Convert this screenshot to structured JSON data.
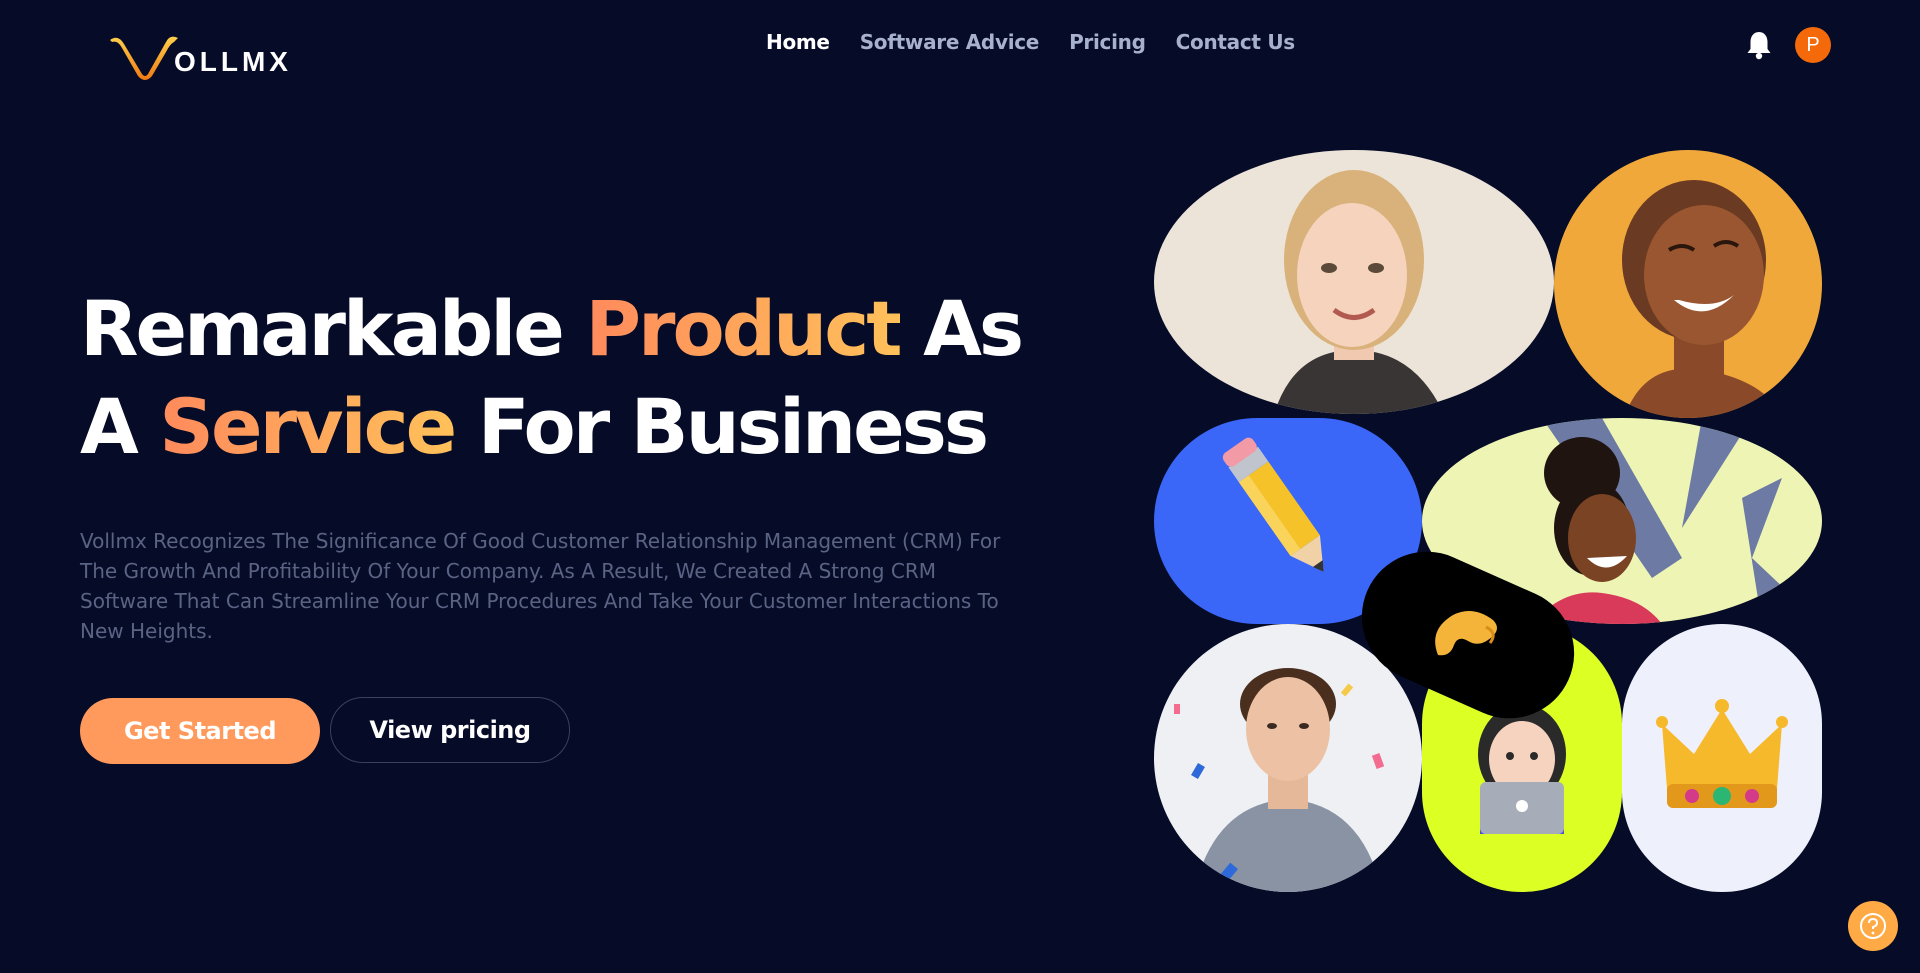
{
  "brand": {
    "logo_letter": "V",
    "logo_text": "OLLMX",
    "accent_color": "#ff9a5c",
    "background": "#060b27"
  },
  "nav": {
    "items": [
      {
        "label": "Home",
        "active": true
      },
      {
        "label": "Software Advice",
        "active": false
      },
      {
        "label": "Pricing",
        "active": false
      },
      {
        "label": "Contact Us",
        "active": false
      }
    ]
  },
  "header_right": {
    "notification_icon": "bell-icon",
    "avatar_initial": "P",
    "avatar_color": "#f46a0a"
  },
  "hero": {
    "title_line1_part1": "Remarkable ",
    "title_line1_accent": "Product",
    "title_line1_part2": " As",
    "title_line2_part1": "A ",
    "title_line2_accent": "Service",
    "title_line2_part2": " For Business",
    "description": "Vollmx Recognizes The Significance Of Good Customer Relationship Management (CRM) For The Growth And Profitability Of Your Company. As A Result, We Created A Strong CRM Software That Can Streamline Your CRM Procedures And Take Your Customer Interactions To New Heights.",
    "primary_button": "Get Started",
    "secondary_button": "View pricing"
  },
  "collage": {
    "tiles": [
      {
        "name": "photo-blonde-woman",
        "kind": "photo"
      },
      {
        "name": "photo-laughing-woman",
        "kind": "photo"
      },
      {
        "name": "pencil-emoji",
        "kind": "emoji",
        "glyph": "✏️",
        "color": "#3a67f8"
      },
      {
        "name": "photo-smiling-girl",
        "kind": "photo"
      },
      {
        "name": "pinching-hand-emoji",
        "kind": "emoji",
        "glyph": "🤌",
        "color": "#000000"
      },
      {
        "name": "photo-young-man",
        "kind": "photo"
      },
      {
        "name": "woman-laptop-emoji",
        "kind": "emoji",
        "glyph": "👩‍💻",
        "color": "#dcff24"
      },
      {
        "name": "crown-emoji",
        "kind": "emoji",
        "glyph": "👑",
        "color": "#eef0fb"
      }
    ]
  },
  "help_button": {
    "icon": "question-icon",
    "color": "#ffaa45"
  }
}
